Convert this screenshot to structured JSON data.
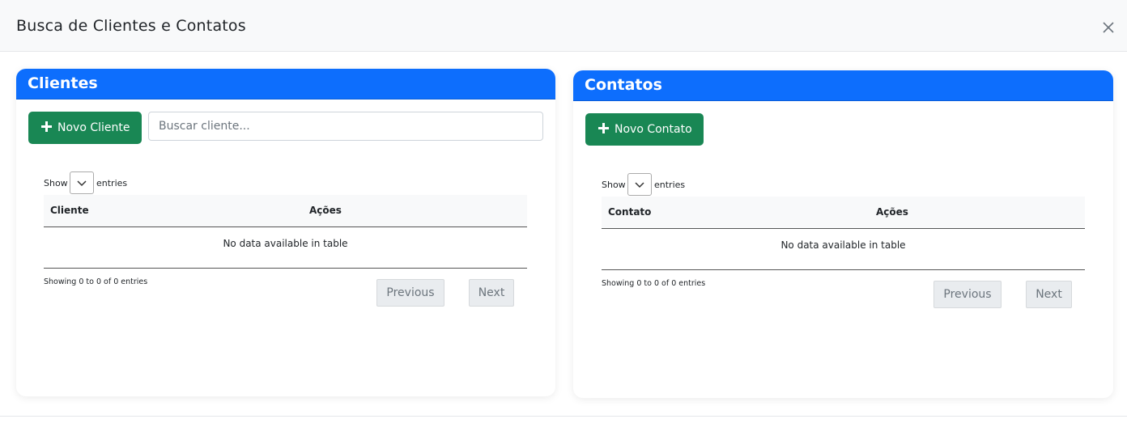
{
  "modal": {
    "title": "Busca de Clientes e Contatos",
    "close_icon": "close-icon"
  },
  "clientes": {
    "title": "Clientes",
    "add_label": "Novo Cliente",
    "search_placeholder": "Buscar cliente...",
    "length": {
      "show_label": "Show",
      "entries_label": "entries"
    },
    "columns": [
      "Cliente",
      "Ações"
    ],
    "empty_text": "No data available in table",
    "info": "Showing 0 to 0 of 0 entries",
    "pagination": {
      "previous": "Previous",
      "next": "Next"
    }
  },
  "contatos": {
    "title": "Contatos",
    "add_label": "Novo Contato",
    "length": {
      "show_label": "Show",
      "entries_label": "entries"
    },
    "columns": [
      "Contato",
      "Ações"
    ],
    "empty_text": "No data available in table",
    "info": "Showing 0 to 0 of 0 entries",
    "pagination": {
      "previous": "Previous",
      "next": "Next"
    }
  },
  "colors": {
    "primary": "#0d6efd",
    "success": "#198754",
    "header_bg": "#f8f9fa",
    "disabled_btn": "#e9ecef"
  }
}
